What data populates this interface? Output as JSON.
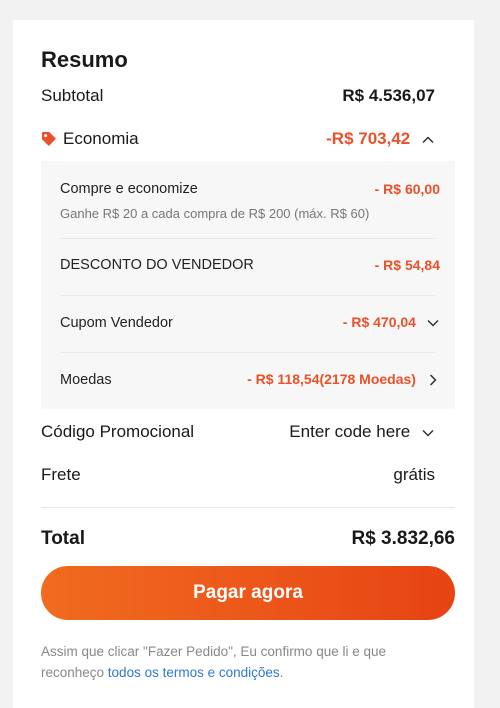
{
  "summary": {
    "title": "Resumo",
    "subtotal": {
      "label": "Subtotal",
      "value": "R$ 4.536,07"
    },
    "savings": {
      "label": "Economia",
      "value": "-R$ 703,42",
      "expanded": true,
      "items": [
        {
          "label": "Compre e economize",
          "amount": "- R$ 60,00",
          "note": "Ganhe R$ 20 a cada compra de R$ 200 (máx. R$ 60)"
        },
        {
          "label": "DESCONTO DO VENDEDOR",
          "amount": "- R$ 54,84"
        },
        {
          "label": "Cupom Vendedor",
          "amount": "- R$ 470,04"
        },
        {
          "label": "Moedas",
          "amount": "- R$ 118,54(2178 Moedas)"
        }
      ]
    },
    "promo": {
      "label": "Código Promocional",
      "value": "Enter code here"
    },
    "shipping": {
      "label": "Frete",
      "value": "grátis"
    },
    "total": {
      "label": "Total",
      "value": "R$ 3.832,66"
    },
    "pay_button": "Pagar agora",
    "disclaimer": {
      "text": "Assim que clicar \"Fazer Pedido\", Eu confirmo que li e que reconheço ",
      "link": "todos os termos e condições",
      "suffix": "."
    }
  },
  "colors": {
    "accent": "#e8512a",
    "link": "#2f76d6",
    "button_start": "#f06b1f",
    "button_end": "#e64312"
  },
  "icons": {
    "savings": "price-tag-icon",
    "collapse": "chevron-up-icon",
    "dropdown": "chevron-down-icon",
    "navigate": "chevron-right-icon"
  }
}
